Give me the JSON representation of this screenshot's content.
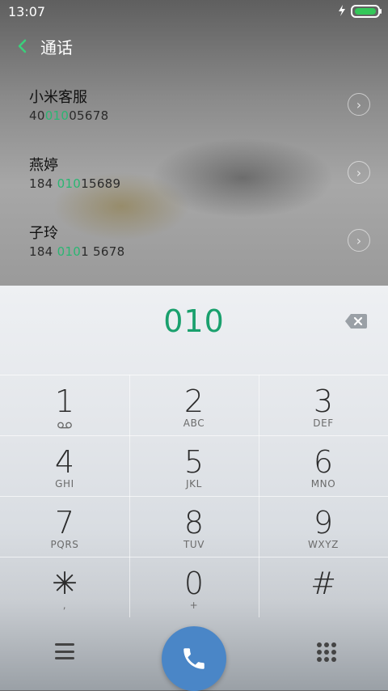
{
  "status_bar": {
    "time": "13:07",
    "icons": {
      "charging": "bolt-icon",
      "battery": "battery-icon"
    }
  },
  "header": {
    "title": "通话",
    "back_icon": "chevron-left-icon"
  },
  "suggestions": [
    {
      "name": "小米客服",
      "number_prefix": "40",
      "number_match": "010",
      "number_suffix": "05678"
    },
    {
      "name": "燕婷",
      "number_prefix": "184 ",
      "number_match": "010",
      "number_suffix": "15689"
    },
    {
      "name": "子玲",
      "number_prefix": "184 ",
      "number_match": "010",
      "number_suffix": "1 5678"
    }
  ],
  "dialer": {
    "dialed": "010",
    "keys": [
      {
        "digit": "1",
        "letters": ""
      },
      {
        "digit": "2",
        "letters": "ABC"
      },
      {
        "digit": "3",
        "letters": "DEF"
      },
      {
        "digit": "4",
        "letters": "GHI"
      },
      {
        "digit": "5",
        "letters": "JKL"
      },
      {
        "digit": "6",
        "letters": "MNO"
      },
      {
        "digit": "7",
        "letters": "PQRS"
      },
      {
        "digit": "8",
        "letters": "TUV"
      },
      {
        "digit": "9",
        "letters": "WXYZ"
      },
      {
        "digit": "✳",
        "letters": ","
      },
      {
        "digit": "0",
        "letters": "+"
      },
      {
        "digit": "#",
        "letters": ""
      }
    ]
  },
  "colors": {
    "accent": "#2bb673",
    "call": "#4a86c7"
  }
}
